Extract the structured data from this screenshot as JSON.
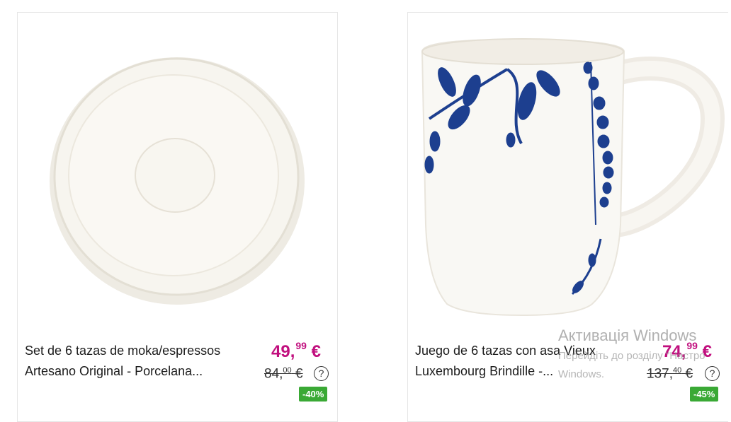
{
  "products": [
    {
      "title_line1": "Set de 6 tazas de moka/espressos",
      "title_line2": "Artesano Original - Porcelana...",
      "price_int": "49,",
      "price_dec": "99",
      "price_cur": "€",
      "old_int": "84,",
      "old_dec": "00",
      "old_cur": "€",
      "help": "?",
      "discount": "-40%",
      "image": "white-saucer"
    },
    {
      "title_line1": "Juego de 6 tazas con asa Vieux",
      "title_line2": "Luxembourg Brindille -...",
      "price_int": "74,",
      "price_dec": "99",
      "price_cur": "€",
      "old_int": "137,",
      "old_dec": "40",
      "old_cur": "€",
      "help": "?",
      "discount": "-45%",
      "image": "blue-leaf-mug"
    }
  ],
  "watermark": {
    "line1": "Активація Windows",
    "line2": "Перейдіть до розділу \"Настро",
    "line3": "Windows."
  },
  "colors": {
    "price": "#c10f7e",
    "badge": "#3aa935",
    "mug_decor": "#1d3f8f"
  }
}
